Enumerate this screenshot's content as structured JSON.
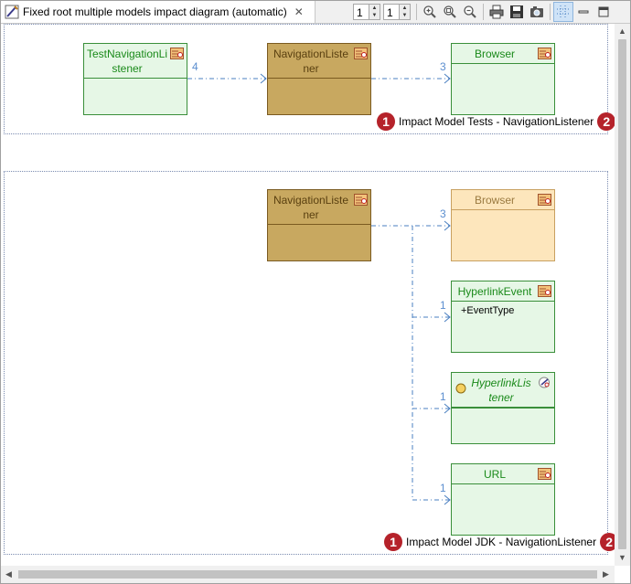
{
  "tab": {
    "title": "Fixed root multiple models impact diagram (automatic)",
    "close_icon": "close-icon"
  },
  "toolbar": {
    "spinner1_value": "1",
    "spinner2_value": "1",
    "buttons": [
      "zoom-in-icon",
      "zoom-fit-icon",
      "zoom-out-icon",
      "print-icon",
      "save-icon",
      "export-image-icon",
      "grid-icon",
      "minimize-icon",
      "maximize-icon"
    ]
  },
  "section1": {
    "classes": [
      {
        "name": "TestNavigationListener",
        "name_lines": [
          "TestNavigationLi",
          "stener"
        ],
        "style": "green"
      },
      {
        "name": "NavigationListener",
        "name_lines": [
          "NavigationListe",
          "ner"
        ],
        "style": "brown"
      },
      {
        "name": "Browser",
        "name_lines": [
          "Browser"
        ],
        "style": "green"
      }
    ],
    "multiplicities": [
      "4",
      "3"
    ],
    "label": {
      "badge_left": "1",
      "text": "Impact Model Tests - NavigationListener",
      "badge_right": "2"
    }
  },
  "section2": {
    "classes": [
      {
        "name": "NavigationListener",
        "name_lines": [
          "NavigationListe",
          "ner"
        ],
        "style": "brown"
      },
      {
        "name": "Browser",
        "name_lines": [
          "Browser"
        ],
        "style": "peach"
      },
      {
        "name": "HyperlinkEvent",
        "name_lines": [
          "HyperlinkEvent"
        ],
        "style": "green",
        "attribute": "+EventType"
      },
      {
        "name": "HyperlinkListener",
        "name_lines": [
          "HyperlinkLis",
          "tener"
        ],
        "style": "interface"
      },
      {
        "name": "URL",
        "name_lines": [
          "URL"
        ],
        "style": "green"
      }
    ],
    "multiplicities": [
      "3",
      "1",
      "1",
      "1"
    ],
    "label": {
      "badge_left": "1",
      "text": "Impact Model JDK - NavigationListener",
      "badge_right": "2"
    }
  },
  "colors": {
    "connector": "#4a7fc0",
    "badge": "#b5222a",
    "class_border": "#3a8f3a",
    "class_fill": "#e6f7e6"
  }
}
